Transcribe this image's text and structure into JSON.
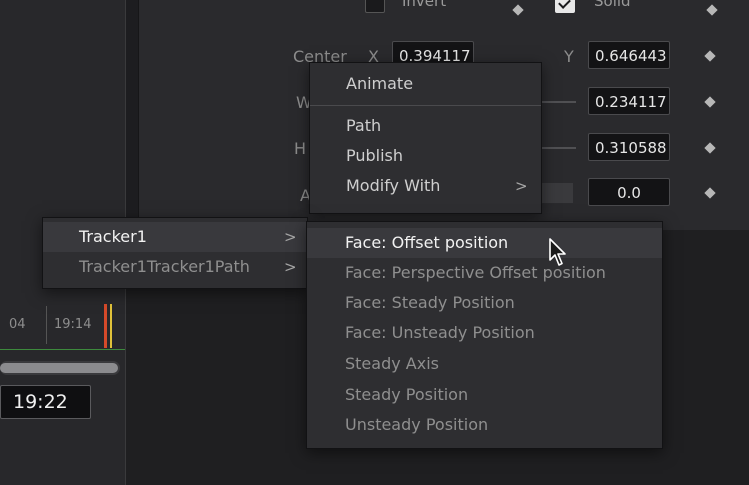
{
  "inspector": {
    "invert_label": "Invert",
    "solid_label": "Solid",
    "center_label": "Center",
    "x_label": "X",
    "y_label": "Y",
    "center_x": "0.394117",
    "center_y": "0.646443",
    "width_label_partial": "W",
    "width_value": "0.234117",
    "height_label_partial": "H",
    "height_value": "0.310588",
    "angle_label_partial": "A",
    "angle_value": "0.0"
  },
  "timeline": {
    "tick_left": "04",
    "tick_right": "19:14",
    "timecode": "19:22"
  },
  "context_menu": {
    "items": [
      {
        "label": "Animate"
      },
      {
        "label": "Path"
      },
      {
        "label": "Publish"
      },
      {
        "label": "Modify With"
      }
    ],
    "chevron": ">"
  },
  "tracker_menu": {
    "items": [
      {
        "label": "Tracker1"
      },
      {
        "label": "Tracker1Tracker1Path"
      }
    ],
    "chevron": ">"
  },
  "position_menu": {
    "items": [
      {
        "label": "Face: Offset position"
      },
      {
        "label": "Face: Perspective Offset position"
      },
      {
        "label": "Face: Steady Position"
      },
      {
        "label": "Face: Unsteady Position"
      },
      {
        "label": "Steady Axis"
      },
      {
        "label": "Steady Position"
      },
      {
        "label": "Unsteady Position"
      }
    ]
  },
  "colors": {
    "highlight": "#39393d",
    "menu_bg": "#2e2e31",
    "playhead_red": "#d64a2a",
    "playhead_yellow": "#e0c23a",
    "track_green": "#3d8a3d"
  }
}
